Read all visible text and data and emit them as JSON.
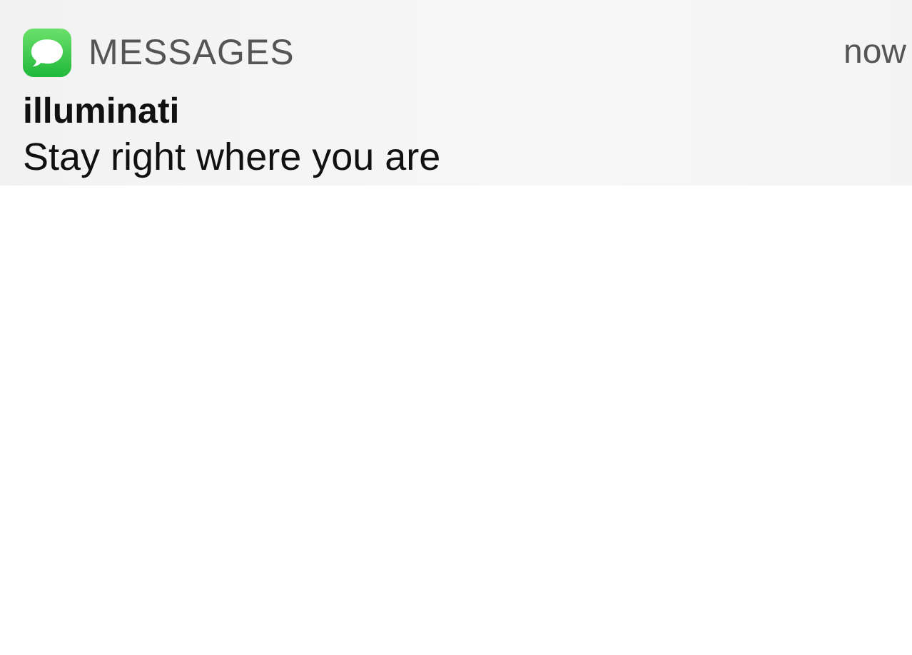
{
  "notification": {
    "app_name": "MESSAGES",
    "time": "now",
    "sender": "illuminati",
    "message": "Stay right where you are"
  }
}
